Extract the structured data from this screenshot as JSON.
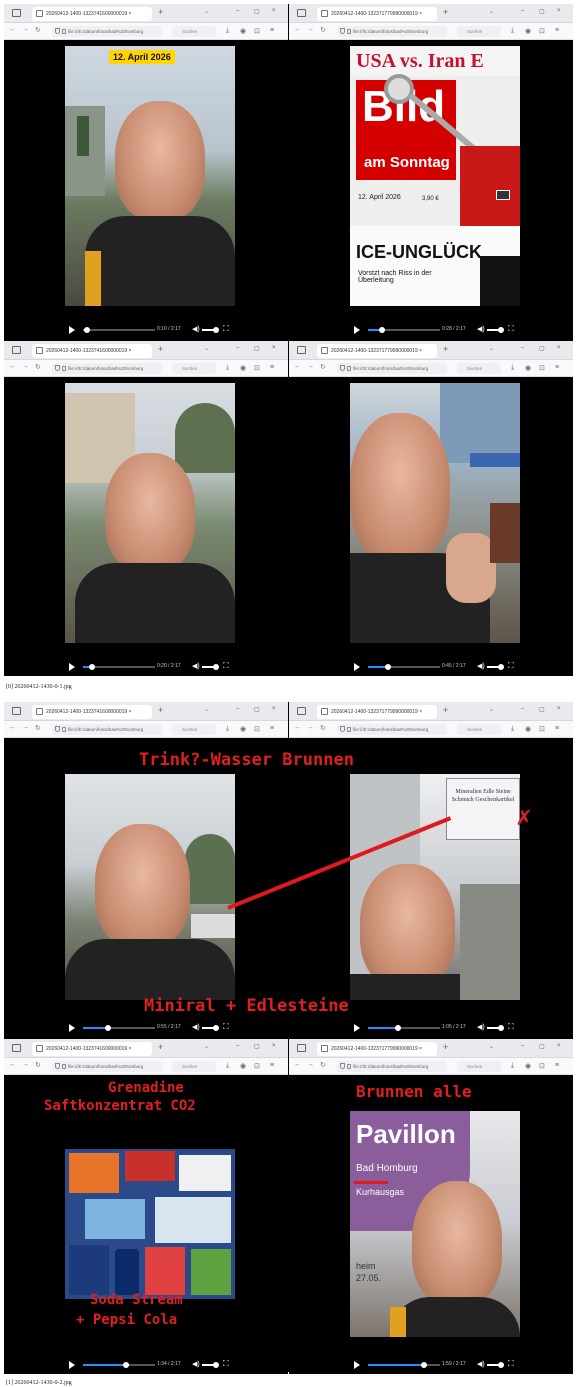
{
  "browser": {
    "tab_title_a": "20260412-1400-1323741600000019 ×",
    "tab_title_b": "20260412-1400-132371779990000019 ×",
    "url": "file:///E:/datum/fotos/bad%20homburg",
    "search_placeholder": "Suchen",
    "new_tab": "+",
    "minimize": "–",
    "maximize": "▢",
    "close": "×"
  },
  "sheets": [
    {
      "caption": "[0] 20260412-1430-0-1.jpg",
      "panes": [
        {
          "time": "0:10 / 2:17",
          "progress": 0.06,
          "badge": "12. April 2026"
        },
        {
          "time": "0:28 / 2:17",
          "progress": 0.2,
          "newspaper": {
            "headline_top": "USA vs. Iran E",
            "masthead": "Bild",
            "sub": "am Sonntag",
            "date": "12. April 2026",
            "price": "3,90 €",
            "headline_bottom": "ICE-UNGLÜCK",
            "subline": "Vorstzt nach Riss in der Überleitung"
          }
        },
        {
          "time": "0:20 / 2:17",
          "progress": 0.12
        },
        {
          "time": "0:45 / 2:17",
          "progress": 0.28
        }
      ]
    },
    {
      "caption": "[1] 20260412-1430-0-2.jpg",
      "panes": [
        {
          "time": "0:55 / 2:17",
          "progress": 0.35
        },
        {
          "time": "1:05 / 2:17",
          "progress": 0.42,
          "sign": "Mineralien Edle Steine Schmuck Geschenkartikel"
        },
        {
          "time": "1:34 / 2:17",
          "progress": 0.6
        },
        {
          "time": "1:59 / 2:17",
          "progress": 0.78,
          "poster": {
            "title": "Pavillon",
            "line1": "Bad Homburg",
            "line2": "Kurhausgas",
            "line3": "heim",
            "line4": "27.05."
          }
        }
      ],
      "overlays": {
        "top_title": "Trink?-Wasser Brunnen",
        "bottom_title": "Miniral + Edlesteine",
        "grenadine_1": "Grenadine",
        "grenadine_2": "Saftkonzentrat CO2",
        "soda_1": "Soda Stream",
        "soda_2": "+ Pepsi Cola",
        "brunnen_alle": "Brunnen alle"
      }
    }
  ]
}
